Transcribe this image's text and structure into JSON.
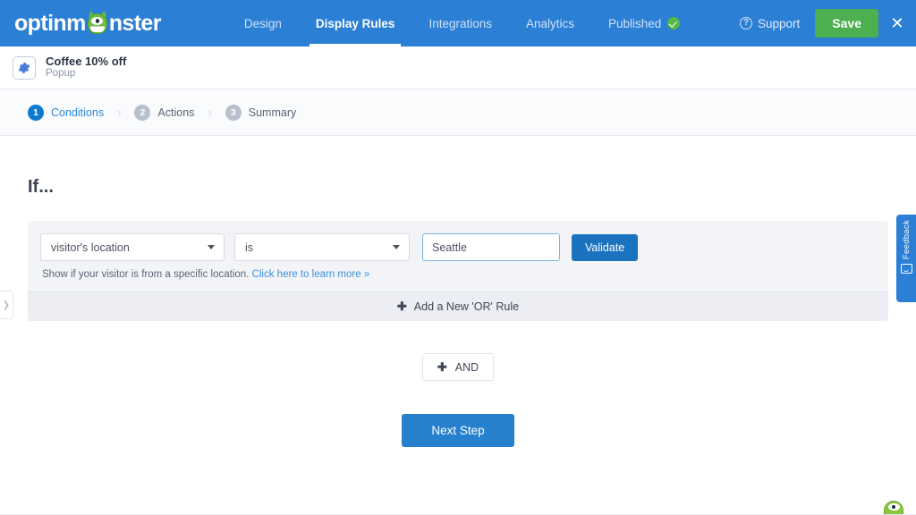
{
  "brand": {
    "logo_text_before": "optinm",
    "logo_text_after": "nster",
    "logo_icon": "monster-mascot-icon",
    "header_bg": "#2b7fd4",
    "accent_blue": "#2680cd",
    "save_green": "#4caf50"
  },
  "topnav": {
    "items": [
      {
        "label": "Design",
        "active": false
      },
      {
        "label": "Display Rules",
        "active": true
      },
      {
        "label": "Integrations",
        "active": false
      },
      {
        "label": "Analytics",
        "active": false
      },
      {
        "label": "Published",
        "active": false,
        "badge": "check-badge"
      }
    ],
    "support_label": "Support",
    "support_icon": "question-circle-icon",
    "save_label": "Save",
    "close_icon": "close-icon"
  },
  "campaign": {
    "icon": "gear-icon",
    "title": "Coffee 10% off",
    "type": "Popup"
  },
  "stepper": {
    "steps": [
      {
        "num": "1",
        "label": "Conditions",
        "active": true
      },
      {
        "num": "2",
        "label": "Actions",
        "active": false
      },
      {
        "num": "3",
        "label": "Summary",
        "active": false
      }
    ],
    "separator": "›"
  },
  "main": {
    "if_title": "If...",
    "rule": {
      "field_select_value": "visitor's location",
      "operator_select_value": "is",
      "value_input": "Seattle",
      "value_input_placeholder": "Seattle",
      "validate_label": "Validate",
      "helper_text": "Show if your visitor is from a specific location.",
      "helper_link": "Click here to learn more »"
    },
    "add_or_rule_label": "Add a New 'OR' Rule",
    "add_or_rule_icon": "plus-icon",
    "and_label": "AND",
    "and_icon": "plus-icon",
    "next_step_label": "Next Step"
  },
  "side": {
    "left_tab_icon": "chevron-right-icon",
    "feedback_label": "Feedback",
    "feedback_icon": "feedback-icon"
  },
  "mascot": {
    "icon": "monster-mascot-icon"
  }
}
